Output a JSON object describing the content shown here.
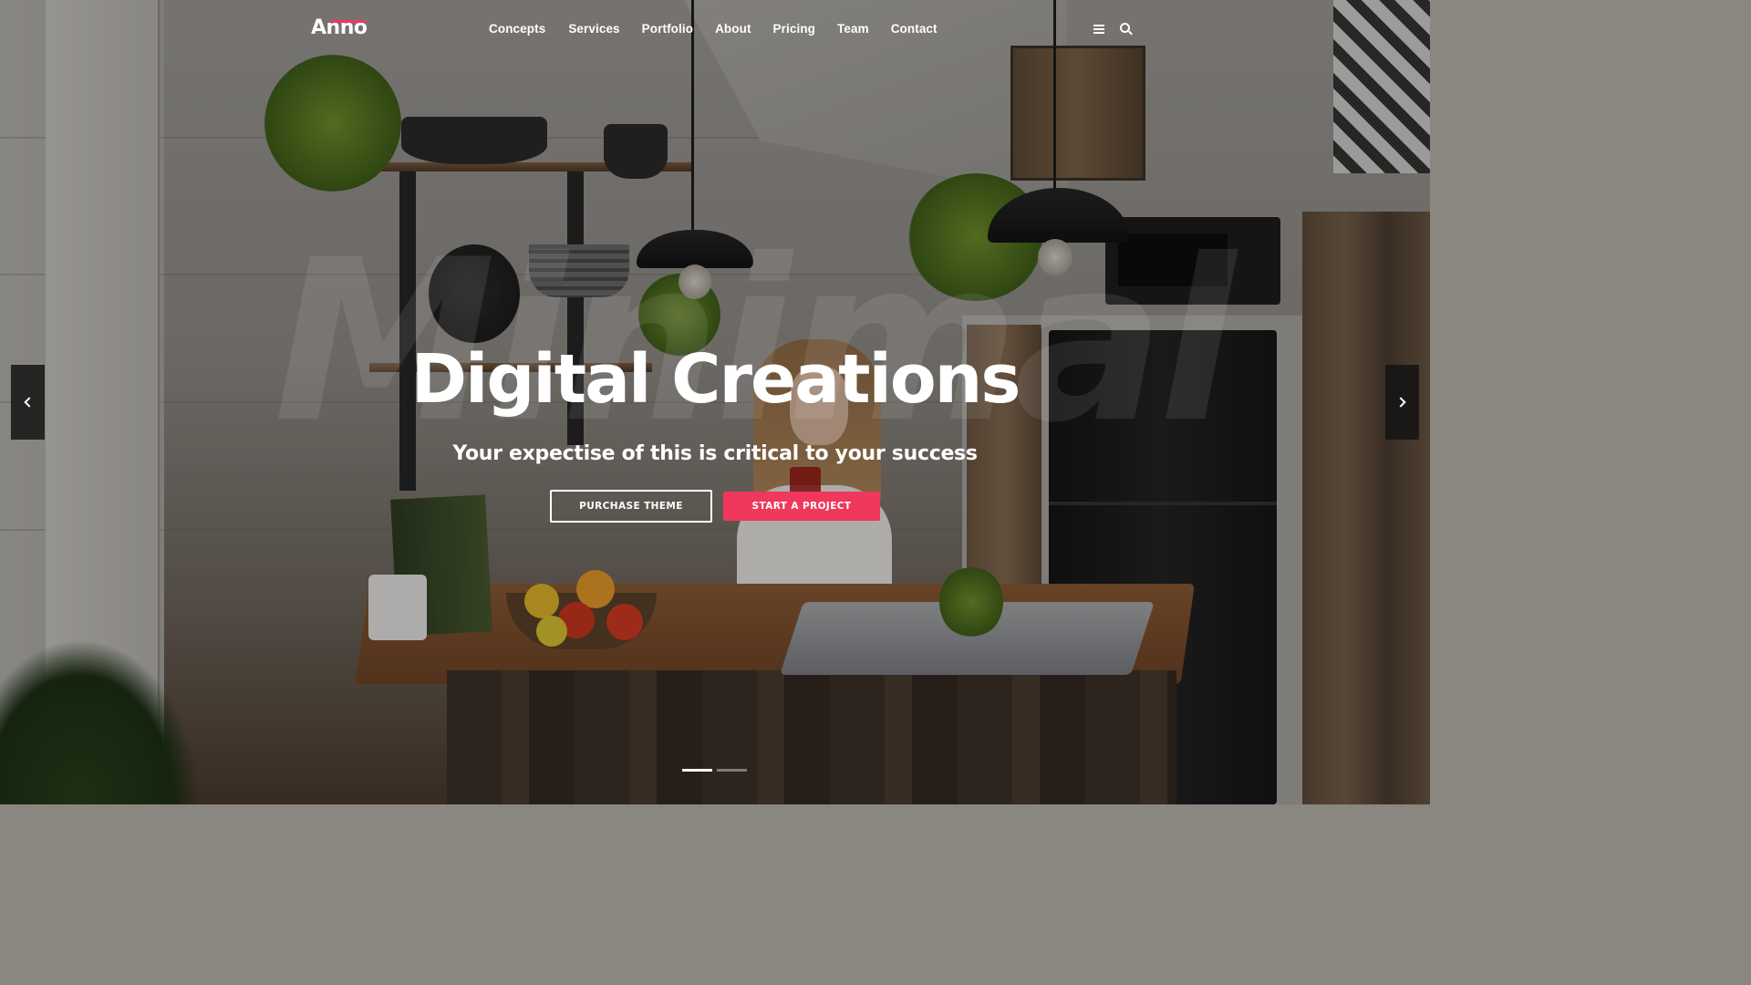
{
  "brand": {
    "logo_text": "Anno",
    "accent_color": "#f0375c"
  },
  "nav": {
    "items": [
      "Concepts",
      "Services",
      "Portfolio",
      "About",
      "Pricing",
      "Team",
      "Contact"
    ]
  },
  "header_icons": [
    "menu-icon",
    "search-icon"
  ],
  "hero": {
    "watermark": "Minimal",
    "title": "Digital Creations",
    "subtitle": "Your expectise of this is critical to your success",
    "primary_button": "PURCHASE THEME",
    "secondary_button": "START A PROJECT"
  },
  "slider": {
    "prev_icon": "chevron-left-icon",
    "next_icon": "chevron-right-icon",
    "slide_count": 2,
    "active_slide": 1
  }
}
